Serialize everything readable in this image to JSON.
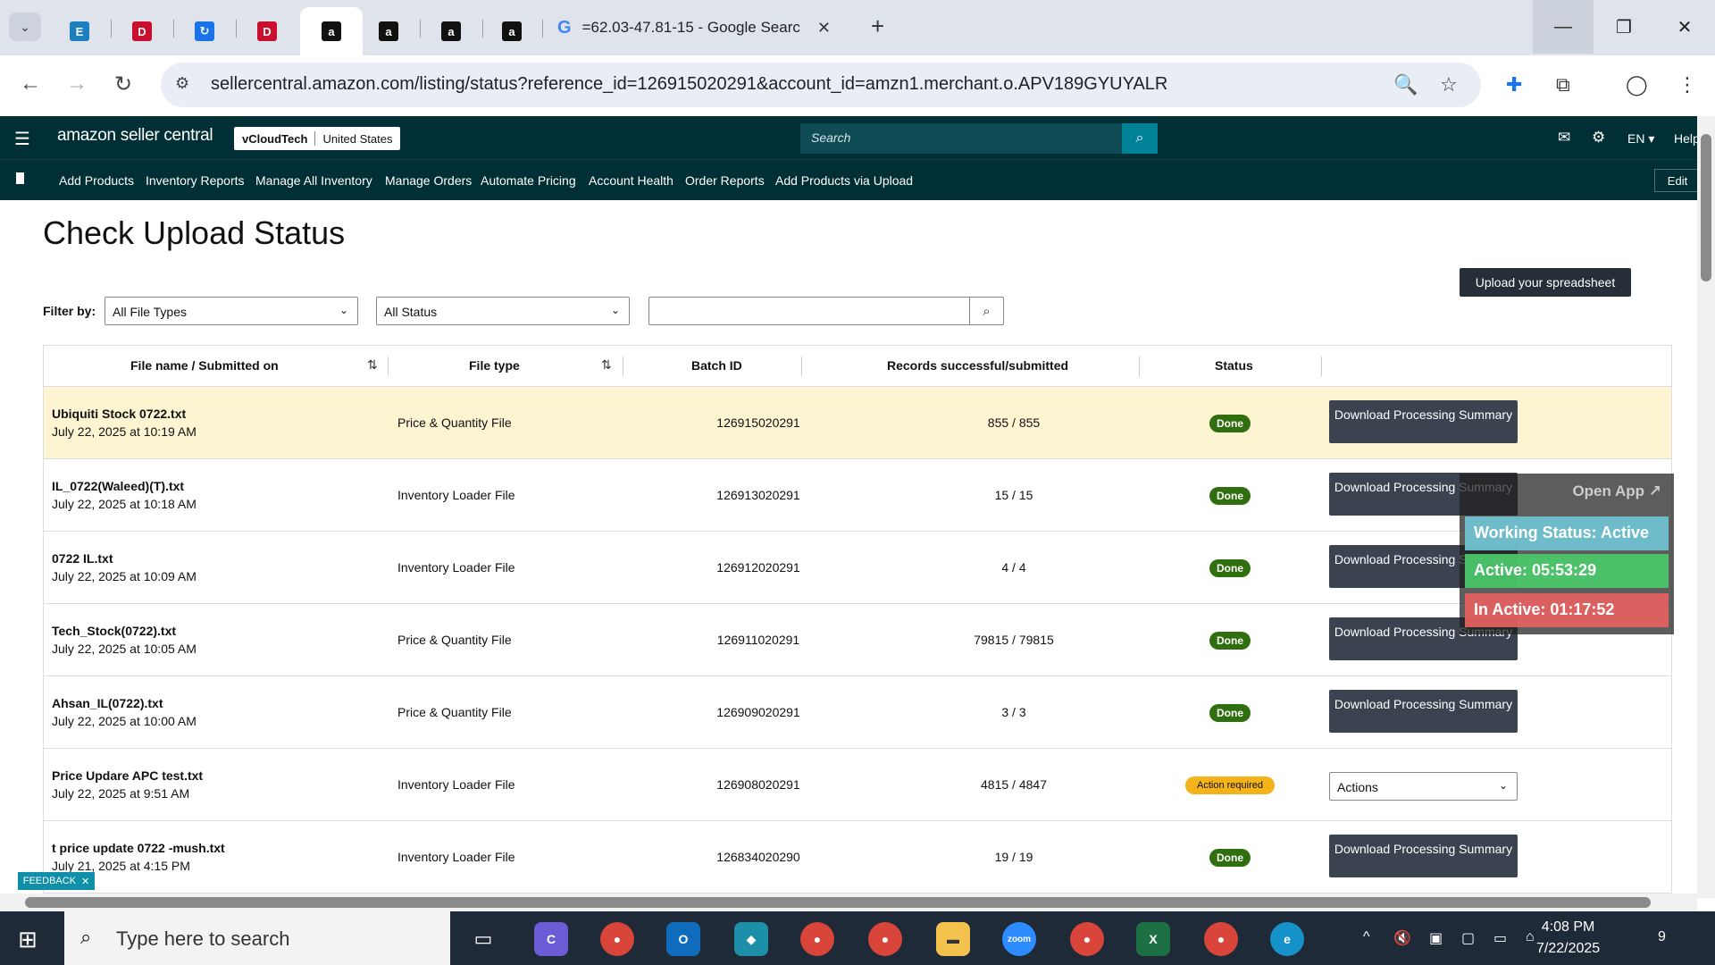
{
  "browser": {
    "tab_google_title": "=62.03-47.81-15 - Google Searc",
    "url": "sellercentral.amazon.com/listing/status?reference_id=126915020291&account_id=amzn1.merchant.o.APV189GYUYALR"
  },
  "header": {
    "logo_text": "amazon seller central",
    "account_name": "vCloudTech",
    "marketplace": "United States",
    "search_placeholder": "Search",
    "language": "EN ▾",
    "help": "Help"
  },
  "nav": {
    "links": [
      "Add Products",
      "Inventory Reports",
      "Manage All Inventory",
      "Manage Orders",
      "Automate Pricing",
      "Account Health",
      "Order Reports",
      "Add Products via Upload"
    ],
    "edit": "Edit"
  },
  "page": {
    "title": "Check Upload Status",
    "upload_button": "Upload your spreadsheet",
    "filter_label": "Filter by:",
    "file_type_select": "All File Types",
    "status_select": "All Status"
  },
  "table": {
    "headers": {
      "file_name": "File name / Submitted on",
      "file_type": "File type",
      "batch_id": "Batch ID",
      "records": "Records successful/submitted",
      "status": "Status"
    },
    "rows": [
      {
        "name": "Ubiquiti Stock 0722.txt",
        "date": "July 22, 2025 at 10:19 AM",
        "type": "Price & Quantity File",
        "batch": "126915020291",
        "records": "855 / 855",
        "status": "Done",
        "action": "Download Processing Summary"
      },
      {
        "name": "IL_0722(Waleed)(T).txt",
        "date": "July 22, 2025 at 10:18 AM",
        "type": "Inventory Loader File",
        "batch": "126913020291",
        "records": "15 / 15",
        "status": "Done",
        "action": "Download Processing Summary"
      },
      {
        "name": "0722 IL.txt",
        "date": "July 22, 2025 at 10:09 AM",
        "type": "Inventory Loader File",
        "batch": "126912020291",
        "records": "4 / 4",
        "status": "Done",
        "action": "Download Processing Summary"
      },
      {
        "name": "Tech_Stock(0722).txt",
        "date": "July 22, 2025 at 10:05 AM",
        "type": "Price & Quantity File",
        "batch": "126911020291",
        "records": "79815 / 79815",
        "status": "Done",
        "action": "Download Processing Summary"
      },
      {
        "name": "Ahsan_IL(0722).txt",
        "date": "July 22, 2025 at 10:00 AM",
        "type": "Price & Quantity File",
        "batch": "126909020291",
        "records": "3 / 3",
        "status": "Done",
        "action": "Download Processing Summary"
      },
      {
        "name": "Price Updare APC test.txt",
        "date": "July 22, 2025 at 9:51 AM",
        "type": "Inventory Loader File",
        "batch": "126908020291",
        "records": "4815 / 4847",
        "status": "Action required",
        "action": "Actions"
      },
      {
        "name": "t price update 0722 -mush.txt",
        "date": "July 21, 2025 at 4:15 PM",
        "type": "Inventory Loader File",
        "batch": "126834020290",
        "records": "19 / 19",
        "status": "Done",
        "action": "Download Processing Summary"
      }
    ]
  },
  "feedback": "FEEDBACK",
  "widget": {
    "open_app": "Open App ↗",
    "working_status": "Working Status: Active",
    "active": "Active: 05:53:29",
    "inactive": "In Active: 01:17:52"
  },
  "taskbar": {
    "search_placeholder": "Type here to search",
    "time": "4:08 PM",
    "date": "7/22/2025",
    "notification_count": "9"
  }
}
